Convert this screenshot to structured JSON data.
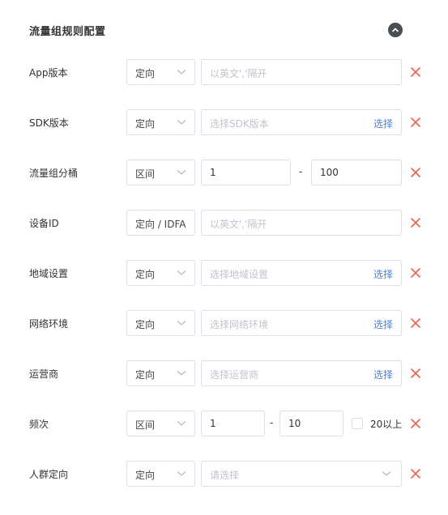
{
  "section": {
    "title": "流量组规则配置",
    "collapse_icon": "chevron-up-circle-icon"
  },
  "rows": [
    {
      "label": "App版本",
      "select": "定向",
      "placeholder": "以英文','隔开"
    },
    {
      "label": "SDK版本",
      "select": "定向",
      "placeholder": "选择SDK版本",
      "pick": "选择"
    },
    {
      "label": "流量组分桶",
      "select": "区间",
      "from": "1",
      "dash": "-",
      "to": "100"
    },
    {
      "label": "设备ID",
      "select": "定向 / IDFA",
      "placeholder": "以英文','隔开"
    },
    {
      "label": "地域设置",
      "select": "定向",
      "placeholder": "选择地域设置",
      "pick": "选择"
    },
    {
      "label": "网络环境",
      "select": "定向",
      "placeholder": "选择网络环境",
      "pick": "选择"
    },
    {
      "label": "运营商",
      "select": "定向",
      "placeholder": "选择运营商",
      "pick": "选择"
    },
    {
      "label": "频次",
      "select": "区间",
      "from": "1",
      "dash": "-",
      "to": "10",
      "checkbox_label": "20以上"
    },
    {
      "label": "人群定向",
      "select": "定向",
      "placeholder": "请选择"
    }
  ],
  "colors": {
    "delete": "#f0604d",
    "pick_link": "#4a7fd6",
    "border": "#dcdfe6"
  }
}
